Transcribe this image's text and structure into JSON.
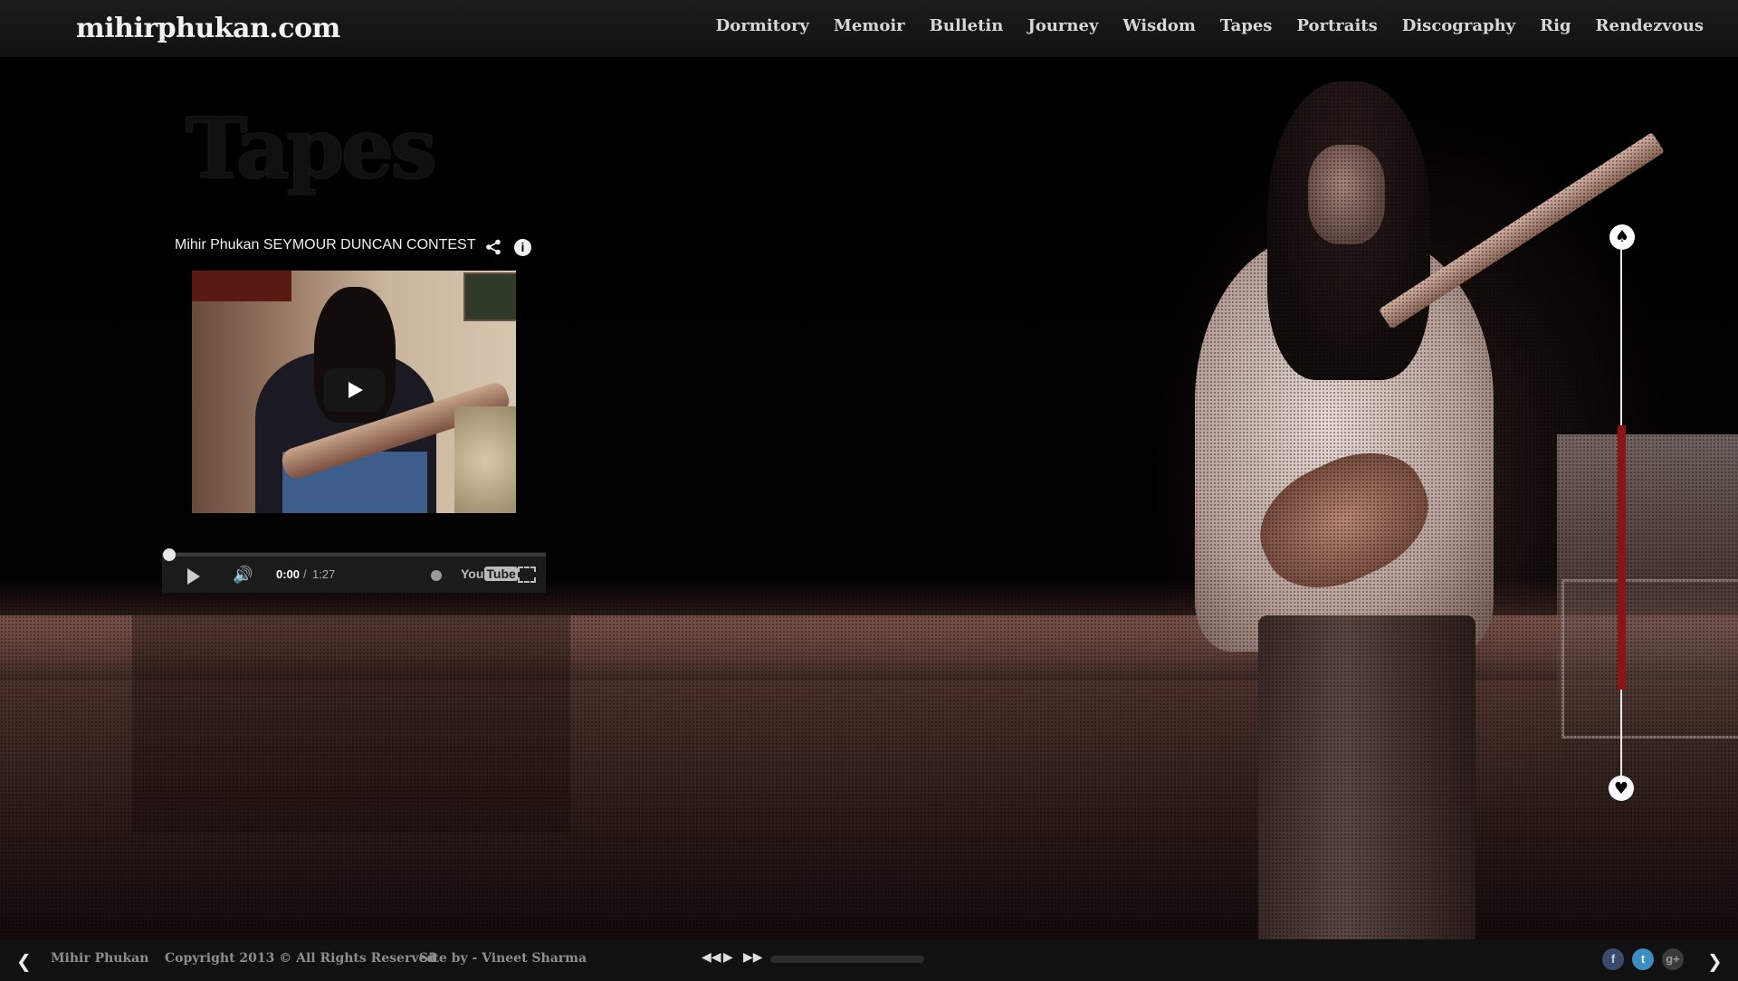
{
  "site": {
    "logo": "mihirphukan.com"
  },
  "nav": {
    "items": [
      "Dormitory",
      "Memoir",
      "Bulletin",
      "Journey",
      "Wisdom",
      "Tapes",
      "Portraits",
      "Discography",
      "Rig",
      "Rendezvous"
    ]
  },
  "page": {
    "title": "Tapes"
  },
  "video": {
    "title": "Mihir Phukan SEYMOUR DUNCAN CONTEST",
    "info_glyph": "i",
    "thumb_wall_text": "",
    "time_current": "0:00",
    "time_separator": "/",
    "time_duration": "1:27",
    "progress_fraction": 0,
    "youtube_logo": "You",
    "youtube_logo_tube": "Tube",
    "volume_glyph": "🔊"
  },
  "scroller": {
    "up_glyph": "♠",
    "down_glyph": "♥"
  },
  "footer": {
    "prev_glyph": "❮",
    "next_glyph": "❯",
    "name": "Mihir Phukan",
    "copyright": "Copyright 2013 © All Rights Reserved",
    "site_by": "Site by - Vineet Sharma",
    "rewind_glyph": "◀◀",
    "play_glyph": "▶",
    "forward_glyph": "▶▶",
    "social": [
      "f",
      "t",
      "g+"
    ]
  },
  "colors": {
    "accent_red": "#8c1414",
    "header_bg": "#1c1c1c",
    "footer_bg": "#111111"
  }
}
